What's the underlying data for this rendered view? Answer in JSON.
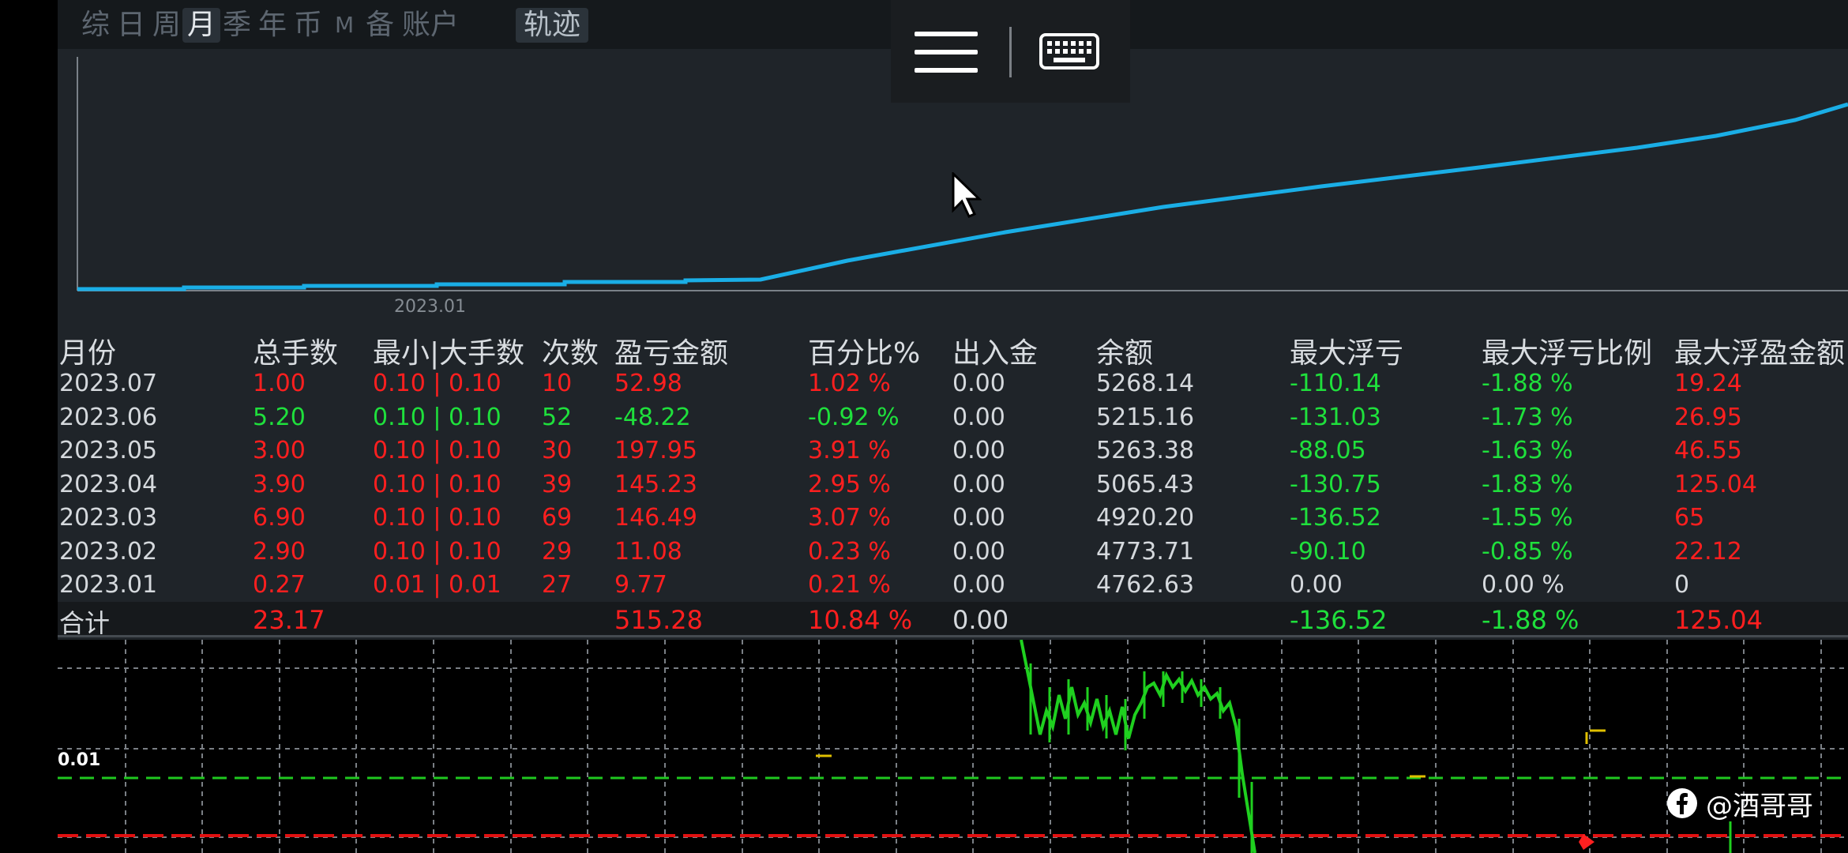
{
  "tabs": [
    {
      "label": "综",
      "active": false
    },
    {
      "label": "日",
      "active": false
    },
    {
      "label": "周",
      "active": false
    },
    {
      "label": "月",
      "active": true
    },
    {
      "label": "季",
      "active": false
    },
    {
      "label": "年",
      "active": false
    },
    {
      "label": "币",
      "active": false
    },
    {
      "label": "M",
      "active": false
    },
    {
      "label": "备",
      "active": false
    },
    {
      "label": "账户",
      "active": false
    }
  ],
  "track_button": "轨迹",
  "equity_chart": {
    "x_tick": "2023.01",
    "line_color": "#1aaee6"
  },
  "table": {
    "headers": [
      "月份",
      "总手数",
      "最小|大手数",
      "次数",
      "盈亏金额",
      "百分比%",
      "出入金",
      "余额",
      "最大浮亏",
      "最大浮亏比例",
      "最大浮盈金额"
    ],
    "rows": [
      {
        "month": "2023.07",
        "lots": "1.00",
        "minmax": "0.10 | 0.10",
        "count": "10",
        "pnl": "52.98",
        "pct": "1.02 %",
        "flow": "0.00",
        "balance": "5268.14",
        "max_dd": "-110.14",
        "max_dd_pct": "-1.88 %",
        "max_float": "19.24",
        "tone": "red"
      },
      {
        "month": "2023.06",
        "lots": "5.20",
        "minmax": "0.10 | 0.10",
        "count": "52",
        "pnl": "-48.22",
        "pct": "-0.92 %",
        "flow": "0.00",
        "balance": "5215.16",
        "max_dd": "-131.03",
        "max_dd_pct": "-1.73 %",
        "max_float": "26.95",
        "tone": "green"
      },
      {
        "month": "2023.05",
        "lots": "3.00",
        "minmax": "0.10 | 0.10",
        "count": "30",
        "pnl": "197.95",
        "pct": "3.91 %",
        "flow": "0.00",
        "balance": "5263.38",
        "max_dd": "-88.05",
        "max_dd_pct": "-1.63 %",
        "max_float": "46.55",
        "tone": "red"
      },
      {
        "month": "2023.04",
        "lots": "3.90",
        "minmax": "0.10 | 0.10",
        "count": "39",
        "pnl": "145.23",
        "pct": "2.95 %",
        "flow": "0.00",
        "balance": "5065.43",
        "max_dd": "-130.75",
        "max_dd_pct": "-1.83 %",
        "max_float": "125.04",
        "tone": "red"
      },
      {
        "month": "2023.03",
        "lots": "6.90",
        "minmax": "0.10 | 0.10",
        "count": "69",
        "pnl": "146.49",
        "pct": "3.07 %",
        "flow": "0.00",
        "balance": "4920.20",
        "max_dd": "-136.52",
        "max_dd_pct": "-1.55 %",
        "max_float": "65",
        "tone": "red"
      },
      {
        "month": "2023.02",
        "lots": "2.90",
        "minmax": "0.10 | 0.10",
        "count": "29",
        "pnl": "11.08",
        "pct": "0.23 %",
        "flow": "0.00",
        "balance": "4773.71",
        "max_dd": "-90.10",
        "max_dd_pct": "-0.85 %",
        "max_float": "22.12",
        "tone": "red"
      },
      {
        "month": "2023.01",
        "lots": "0.27",
        "minmax": "0.01 | 0.01",
        "count": "27",
        "pnl": "9.77",
        "pct": "0.21 %",
        "flow": "0.00",
        "balance": "4762.63",
        "max_dd": "0.00",
        "max_dd_pct": "0.00 %",
        "max_float": "0",
        "tone": "red",
        "neutral_tail": true
      }
    ],
    "total": {
      "label": "合计",
      "lots": "23.17",
      "pnl": "515.28",
      "pct": "10.84 %",
      "flow": "0.00",
      "max_dd": "-136.52",
      "max_dd_pct": "-1.88 %",
      "max_float": "125.04"
    }
  },
  "price_chart": {
    "label": "0.01"
  },
  "watermark": "@酒哥哥",
  "colors": {
    "red": "#ff1f1f",
    "green": "#1fe03c",
    "white": "#d5d9dd",
    "accent": "#1aaee6"
  }
}
